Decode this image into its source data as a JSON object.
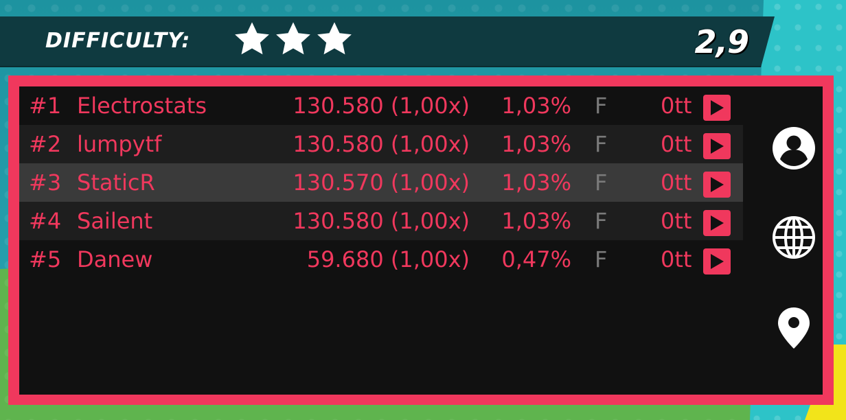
{
  "header": {
    "difficulty_label": "DIFFICULTY:",
    "stars_filled": 3,
    "difficulty_value": "2,9"
  },
  "leaderboard": {
    "rows": [
      {
        "rank": "#1",
        "name": "Electrostats",
        "score": "130.580 (1,00x)",
        "accuracy": "1,03%",
        "grade": "F",
        "pp": "0tt"
      },
      {
        "rank": "#2",
        "name": "lumpytf",
        "score": "130.580 (1,00x)",
        "accuracy": "1,03%",
        "grade": "F",
        "pp": "0tt"
      },
      {
        "rank": "#3",
        "name": "StaticR",
        "score": "130.570 (1,00x)",
        "accuracy": "1,03%",
        "grade": "F",
        "pp": "0tt"
      },
      {
        "rank": "#4",
        "name": "Sailent",
        "score": "130.580 (1,00x)",
        "accuracy": "1,03%",
        "grade": "F",
        "pp": "0tt"
      },
      {
        "rank": "#5",
        "name": "Danew",
        "score": "59.680 (1,00x)",
        "accuracy": "0,47%",
        "grade": "F",
        "pp": "0tt"
      }
    ],
    "selected_index": 2
  },
  "side_icons": [
    "user-icon",
    "globe-icon",
    "location-pin-icon"
  ],
  "colors": {
    "accent": "#f0385d",
    "panel_bg": "#111111",
    "header_bg": "#0f3a40",
    "grade": "#7a7a7a"
  }
}
